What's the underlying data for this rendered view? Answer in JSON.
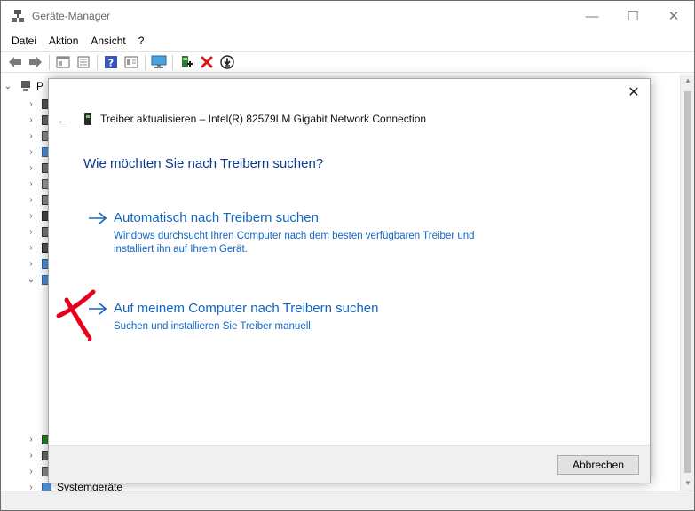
{
  "window": {
    "title": "Geräte-Manager",
    "controls": {
      "minimize": "—",
      "maximize": "☐",
      "close": "✕"
    }
  },
  "menu": [
    "Datei",
    "Aktion",
    "Ansicht",
    "?"
  ],
  "toolbar": {
    "icons": [
      "back-arrow-icon",
      "forward-arrow-icon",
      "properties-list-icon",
      "console-icon",
      "help-icon",
      "details-view-icon",
      "monitor-icon",
      "add-driver-icon",
      "remove-device-icon",
      "download-driver-icon"
    ]
  },
  "tree": {
    "root_label": "P",
    "bottom_item_label": "Systemgeräte"
  },
  "dialog": {
    "close": "✕",
    "back": "←",
    "header": "Treiber aktualisieren – Intel(R) 82579LM Gigabit Network Connection",
    "question": "Wie möchten Sie nach Treibern suchen?",
    "options": [
      {
        "title": "Automatisch nach Treibern suchen",
        "description": "Windows durchsucht Ihren Computer nach dem besten verfügbaren Treiber und installiert ihn auf Ihrem Gerät."
      },
      {
        "title": "Auf meinem Computer nach Treibern suchen",
        "description": "Suchen und installieren Sie Treiber manuell."
      }
    ],
    "cancel_label": "Abbrechen"
  },
  "colors": {
    "link_blue": "#1166c4",
    "heading_blue": "#0a3a8c",
    "annotation_red": "#e8001c",
    "remove_red": "#d8141e"
  }
}
